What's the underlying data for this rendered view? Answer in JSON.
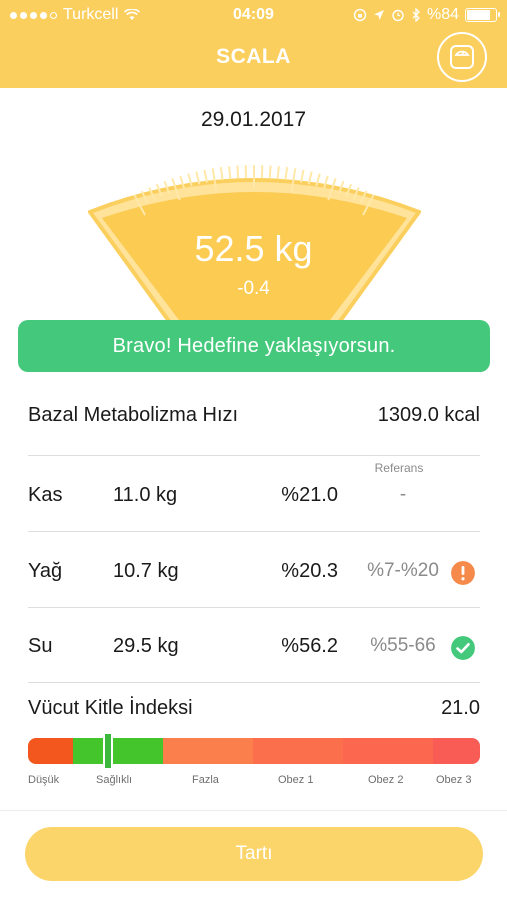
{
  "status_bar": {
    "carrier": "Turkcell",
    "time": "04:09",
    "battery": "%84",
    "battery_level": 0.84
  },
  "header": {
    "title": "SCALA",
    "scale_icon": "scale-icon"
  },
  "measurement": {
    "date": "29.01.2017",
    "weight": "52.5 kg",
    "change": "-0.4"
  },
  "banner": {
    "text": "Bravo! Hedefine yaklaşıyorsun."
  },
  "bmr": {
    "label": "Bazal Metabolizma Hızı",
    "value": "1309.0 kcal"
  },
  "reference_header": "Referans",
  "rows": [
    {
      "name": "Kas",
      "kg": "11.0 kg",
      "pct": "%21.0",
      "ref": "-",
      "status": "none"
    },
    {
      "name": "Yağ",
      "kg": "10.7 kg",
      "pct": "%20.3",
      "ref": "%7-%20",
      "status": "warning"
    },
    {
      "name": "Su",
      "kg": "29.5 kg",
      "pct": "%56.2",
      "ref": "%55-66",
      "status": "ok"
    }
  ],
  "bmi": {
    "label": "Vücut Kitle İndeksi",
    "value": "21.0",
    "categories": [
      "Düşük",
      "Sağlıklı",
      "Fazla",
      "Obez 1",
      "Obez 2",
      "Obez 3"
    ],
    "colors": [
      "#f4571e",
      "#44c52b",
      "#fb7e4d",
      "#fb6f4d",
      "#fb674f",
      "#f95b55"
    ]
  },
  "colors": {
    "accent": "#fbcf5e",
    "success": "#44c97c",
    "warning": "#f58a4b"
  },
  "action": {
    "weigh_label": "Tartı"
  }
}
